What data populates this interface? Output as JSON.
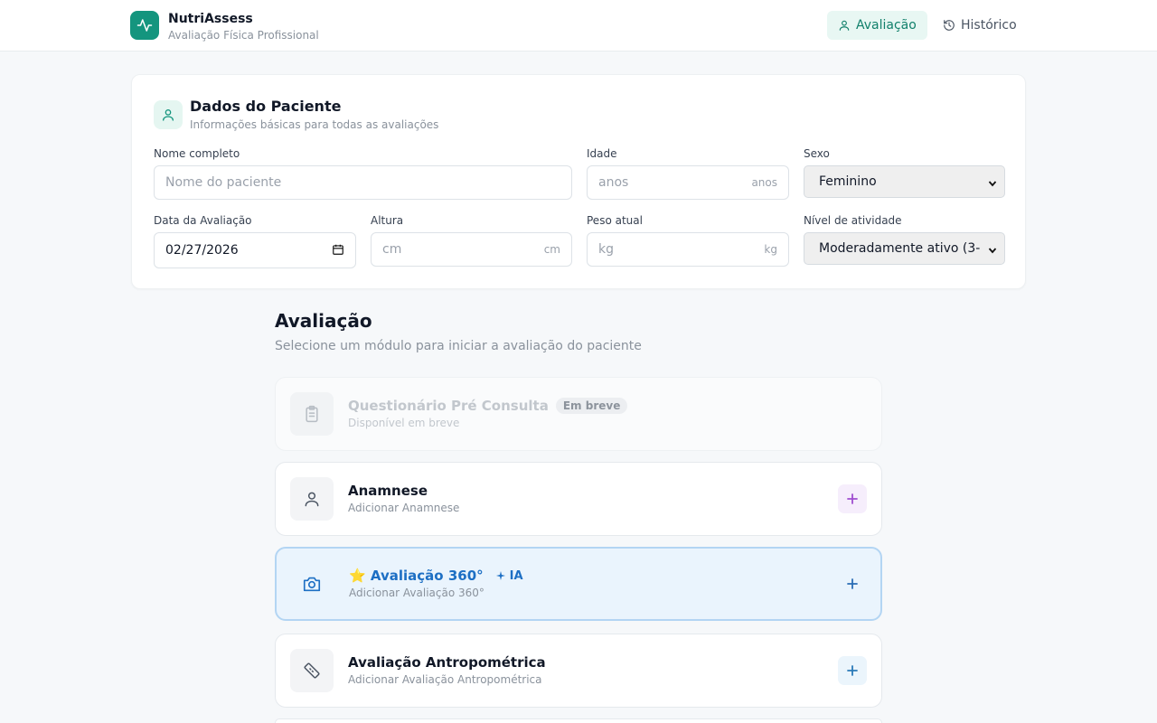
{
  "header": {
    "app_name": "NutriAssess",
    "app_subtitle": "Avaliação Física Profissional",
    "nav": [
      {
        "label": "Avaliação",
        "icon": "user-icon",
        "active": true
      },
      {
        "label": "Histórico",
        "icon": "history-icon",
        "active": false
      }
    ]
  },
  "patient": {
    "title": "Dados do Paciente",
    "subtitle": "Informações básicas para todas as avaliações",
    "fields": {
      "name": {
        "label": "Nome completo",
        "placeholder": "Nome do paciente"
      },
      "age": {
        "label": "Idade",
        "placeholder": "anos",
        "unit": "anos"
      },
      "sex": {
        "label": "Sexo",
        "value": "Feminino"
      },
      "date": {
        "label": "Data da Avaliação",
        "value": "02/27/2026"
      },
      "height": {
        "label": "Altura",
        "placeholder": "cm",
        "unit": "cm"
      },
      "weight": {
        "label": "Peso atual",
        "placeholder": "kg",
        "unit": "kg"
      },
      "activity": {
        "label": "Nível de atividade",
        "value": "Moderadamente ativo (3-"
      }
    }
  },
  "section": {
    "title": "Avaliação",
    "subtitle": "Selecione um módulo para iniciar a avaliação do paciente"
  },
  "modules": [
    {
      "title": "Questionário Pré Consulta",
      "badge": "Em breve",
      "subtitle": "Disponível em breve",
      "icon": "clipboard-icon",
      "state": "disabled"
    },
    {
      "title": "Anamnese",
      "subtitle": "Adicionar Anamnese",
      "icon": "user-icon",
      "state": "default",
      "accent": "#a04dcf"
    },
    {
      "title": "⭐ Avaliação 360°",
      "tag": "IA",
      "subtitle": "Adicionar Avaliação 360°",
      "icon": "camera-icon",
      "state": "selected",
      "accent": "#1d6fc4"
    },
    {
      "title": "Avaliação Antropométrica",
      "subtitle": "Adicionar Avaliação Antropométrica",
      "icon": "ruler-icon",
      "state": "default",
      "accent": "#2a7ab8"
    }
  ],
  "colors": {
    "brand": "#14957e",
    "selected_bg": "#eaf4fd",
    "selected_border": "#b3d5f3"
  }
}
